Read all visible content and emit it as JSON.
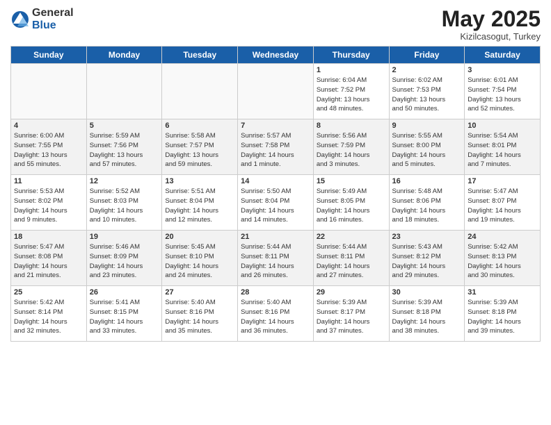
{
  "logo": {
    "general": "General",
    "blue": "Blue"
  },
  "title": "May 2025",
  "location": "Kizilcasogut, Turkey",
  "headers": [
    "Sunday",
    "Monday",
    "Tuesday",
    "Wednesday",
    "Thursday",
    "Friday",
    "Saturday"
  ],
  "weeks": [
    [
      {
        "day": "",
        "info": ""
      },
      {
        "day": "",
        "info": ""
      },
      {
        "day": "",
        "info": ""
      },
      {
        "day": "",
        "info": ""
      },
      {
        "day": "1",
        "info": "Sunrise: 6:04 AM\nSunset: 7:52 PM\nDaylight: 13 hours\nand 48 minutes."
      },
      {
        "day": "2",
        "info": "Sunrise: 6:02 AM\nSunset: 7:53 PM\nDaylight: 13 hours\nand 50 minutes."
      },
      {
        "day": "3",
        "info": "Sunrise: 6:01 AM\nSunset: 7:54 PM\nDaylight: 13 hours\nand 52 minutes."
      }
    ],
    [
      {
        "day": "4",
        "info": "Sunrise: 6:00 AM\nSunset: 7:55 PM\nDaylight: 13 hours\nand 55 minutes."
      },
      {
        "day": "5",
        "info": "Sunrise: 5:59 AM\nSunset: 7:56 PM\nDaylight: 13 hours\nand 57 minutes."
      },
      {
        "day": "6",
        "info": "Sunrise: 5:58 AM\nSunset: 7:57 PM\nDaylight: 13 hours\nand 59 minutes."
      },
      {
        "day": "7",
        "info": "Sunrise: 5:57 AM\nSunset: 7:58 PM\nDaylight: 14 hours\nand 1 minute."
      },
      {
        "day": "8",
        "info": "Sunrise: 5:56 AM\nSunset: 7:59 PM\nDaylight: 14 hours\nand 3 minutes."
      },
      {
        "day": "9",
        "info": "Sunrise: 5:55 AM\nSunset: 8:00 PM\nDaylight: 14 hours\nand 5 minutes."
      },
      {
        "day": "10",
        "info": "Sunrise: 5:54 AM\nSunset: 8:01 PM\nDaylight: 14 hours\nand 7 minutes."
      }
    ],
    [
      {
        "day": "11",
        "info": "Sunrise: 5:53 AM\nSunset: 8:02 PM\nDaylight: 14 hours\nand 9 minutes."
      },
      {
        "day": "12",
        "info": "Sunrise: 5:52 AM\nSunset: 8:03 PM\nDaylight: 14 hours\nand 10 minutes."
      },
      {
        "day": "13",
        "info": "Sunrise: 5:51 AM\nSunset: 8:04 PM\nDaylight: 14 hours\nand 12 minutes."
      },
      {
        "day": "14",
        "info": "Sunrise: 5:50 AM\nSunset: 8:04 PM\nDaylight: 14 hours\nand 14 minutes."
      },
      {
        "day": "15",
        "info": "Sunrise: 5:49 AM\nSunset: 8:05 PM\nDaylight: 14 hours\nand 16 minutes."
      },
      {
        "day": "16",
        "info": "Sunrise: 5:48 AM\nSunset: 8:06 PM\nDaylight: 14 hours\nand 18 minutes."
      },
      {
        "day": "17",
        "info": "Sunrise: 5:47 AM\nSunset: 8:07 PM\nDaylight: 14 hours\nand 19 minutes."
      }
    ],
    [
      {
        "day": "18",
        "info": "Sunrise: 5:47 AM\nSunset: 8:08 PM\nDaylight: 14 hours\nand 21 minutes."
      },
      {
        "day": "19",
        "info": "Sunrise: 5:46 AM\nSunset: 8:09 PM\nDaylight: 14 hours\nand 23 minutes."
      },
      {
        "day": "20",
        "info": "Sunrise: 5:45 AM\nSunset: 8:10 PM\nDaylight: 14 hours\nand 24 minutes."
      },
      {
        "day": "21",
        "info": "Sunrise: 5:44 AM\nSunset: 8:11 PM\nDaylight: 14 hours\nand 26 minutes."
      },
      {
        "day": "22",
        "info": "Sunrise: 5:44 AM\nSunset: 8:11 PM\nDaylight: 14 hours\nand 27 minutes."
      },
      {
        "day": "23",
        "info": "Sunrise: 5:43 AM\nSunset: 8:12 PM\nDaylight: 14 hours\nand 29 minutes."
      },
      {
        "day": "24",
        "info": "Sunrise: 5:42 AM\nSunset: 8:13 PM\nDaylight: 14 hours\nand 30 minutes."
      }
    ],
    [
      {
        "day": "25",
        "info": "Sunrise: 5:42 AM\nSunset: 8:14 PM\nDaylight: 14 hours\nand 32 minutes."
      },
      {
        "day": "26",
        "info": "Sunrise: 5:41 AM\nSunset: 8:15 PM\nDaylight: 14 hours\nand 33 minutes."
      },
      {
        "day": "27",
        "info": "Sunrise: 5:40 AM\nSunset: 8:16 PM\nDaylight: 14 hours\nand 35 minutes."
      },
      {
        "day": "28",
        "info": "Sunrise: 5:40 AM\nSunset: 8:16 PM\nDaylight: 14 hours\nand 36 minutes."
      },
      {
        "day": "29",
        "info": "Sunrise: 5:39 AM\nSunset: 8:17 PM\nDaylight: 14 hours\nand 37 minutes."
      },
      {
        "day": "30",
        "info": "Sunrise: 5:39 AM\nSunset: 8:18 PM\nDaylight: 14 hours\nand 38 minutes."
      },
      {
        "day": "31",
        "info": "Sunrise: 5:39 AM\nSunset: 8:18 PM\nDaylight: 14 hours\nand 39 minutes."
      }
    ]
  ]
}
